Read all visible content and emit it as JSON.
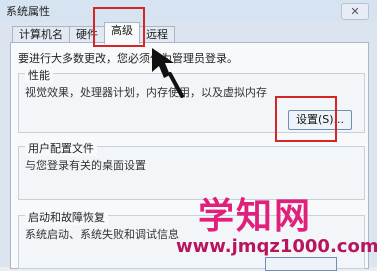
{
  "window": {
    "title": "系统属性",
    "close_glyph": "✕"
  },
  "tabs": [
    {
      "label": "计算机名",
      "active": false
    },
    {
      "label": "硬件",
      "active": false
    },
    {
      "label": "高级",
      "active": true
    },
    {
      "label": "远程",
      "active": false
    }
  ],
  "notice": "要进行大多数更改，您必须作为管理员登录。",
  "performance": {
    "title": "性能",
    "description": "视觉效果，处理器计划，内存使用，以及虚拟内存",
    "button": "设置(S)..."
  },
  "user_profiles": {
    "title": "用户配置文件",
    "description": "与您登录有关的桌面设置"
  },
  "startup_recovery": {
    "title": "启动和故障恢复",
    "description": "系统启动、系统失败和调试信息"
  },
  "watermark": {
    "brand": "学知网",
    "url": "www.jmqz1000.com"
  },
  "colors": {
    "highlight": "#d42626",
    "watermark": "#e0207a"
  },
  "icons": {
    "arrow": "pointer-arrow-icon"
  }
}
